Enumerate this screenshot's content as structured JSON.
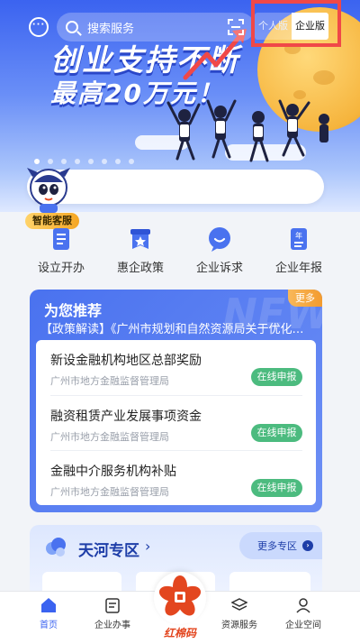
{
  "banner": {
    "headline_line1": "创业支持不断",
    "headline_line2": "最高20万元！",
    "slide_count": 8,
    "active_slide": 1
  },
  "topbar": {
    "search_placeholder": "搜索服务",
    "toggle_personal": "个人版",
    "toggle_enterprise": "企业版"
  },
  "assistant": {
    "label": "智能客服"
  },
  "quick_nav": [
    {
      "label": "设立开办",
      "icon": "document-icon"
    },
    {
      "label": "惠企政策",
      "icon": "policy-star-icon"
    },
    {
      "label": "企业诉求",
      "icon": "chat-bubble-icon"
    },
    {
      "label": "企业年报",
      "icon": "annual-report-icon"
    }
  ],
  "recommend": {
    "title": "为您推荐",
    "more": "更多",
    "watermark": "NEW",
    "ticker": "【政策解读】《广州市规划和自然资源局关于优化…",
    "items": [
      {
        "name": "新设金融机构地区总部奖励",
        "org": "广州市地方金融监督管理局",
        "action": "在线申报"
      },
      {
        "name": "融资租赁产业发展事项资金",
        "org": "广州市地方金融监督管理局",
        "action": "在线申报"
      },
      {
        "name": "金融中介服务机构补贴",
        "org": "广州市地方金融监督管理局",
        "action": "在线申报"
      }
    ]
  },
  "tianhe": {
    "title": "天河专区",
    "more": "更多专区"
  },
  "tabbar": {
    "home": "首页",
    "affairs": "企业办事",
    "center": "红棉码",
    "resources": "资源服务",
    "space": "企业空间"
  },
  "colors": {
    "primary": "#3b63f0",
    "accent_orange": "#f39b2f",
    "apply_green": "#4cbb7f",
    "highlight_red": "#f04848"
  }
}
